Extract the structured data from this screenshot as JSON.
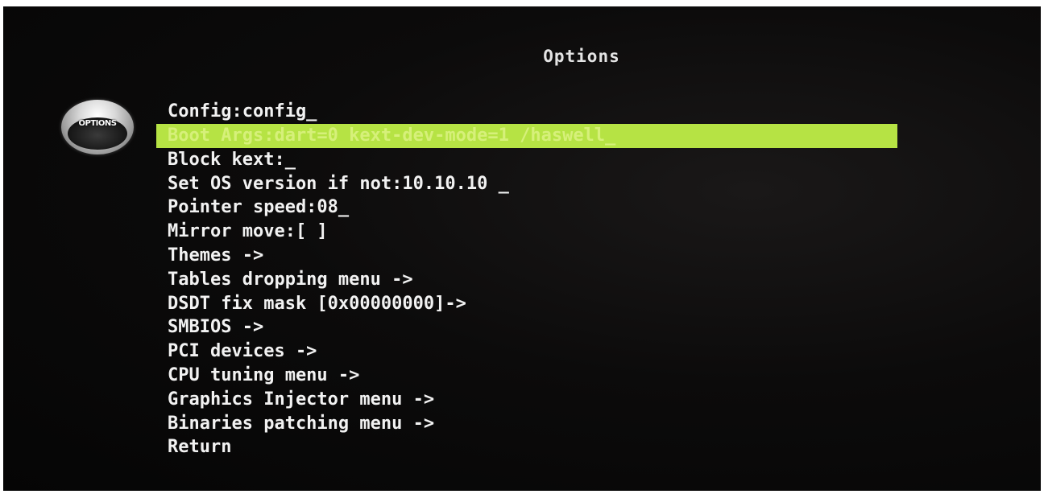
{
  "header": {
    "title": "Options"
  },
  "logo": {
    "label": "OPTIONS"
  },
  "menu": {
    "selected_index": 1,
    "highlight_color": "#b6e344",
    "items": [
      {
        "label": "Config:config_"
      },
      {
        "label": "Boot Args:dart=0 kext-dev-mode=1 /haswell_"
      },
      {
        "label": "Block kext:_"
      },
      {
        "label": "Set OS version if not:10.10.10 _"
      },
      {
        "label": "Pointer speed:08_"
      },
      {
        "label": "Mirror move:[ ]"
      },
      {
        "label": "Themes ->"
      },
      {
        "label": "Tables dropping menu ->"
      },
      {
        "label": "DSDT fix mask [0x00000000]->"
      },
      {
        "label": "SMBIOS ->"
      },
      {
        "label": "PCI devices ->"
      },
      {
        "label": "CPU tuning menu ->"
      },
      {
        "label": "Graphics Injector menu ->"
      },
      {
        "label": "Binaries patching menu ->"
      },
      {
        "label": "Return"
      }
    ]
  }
}
